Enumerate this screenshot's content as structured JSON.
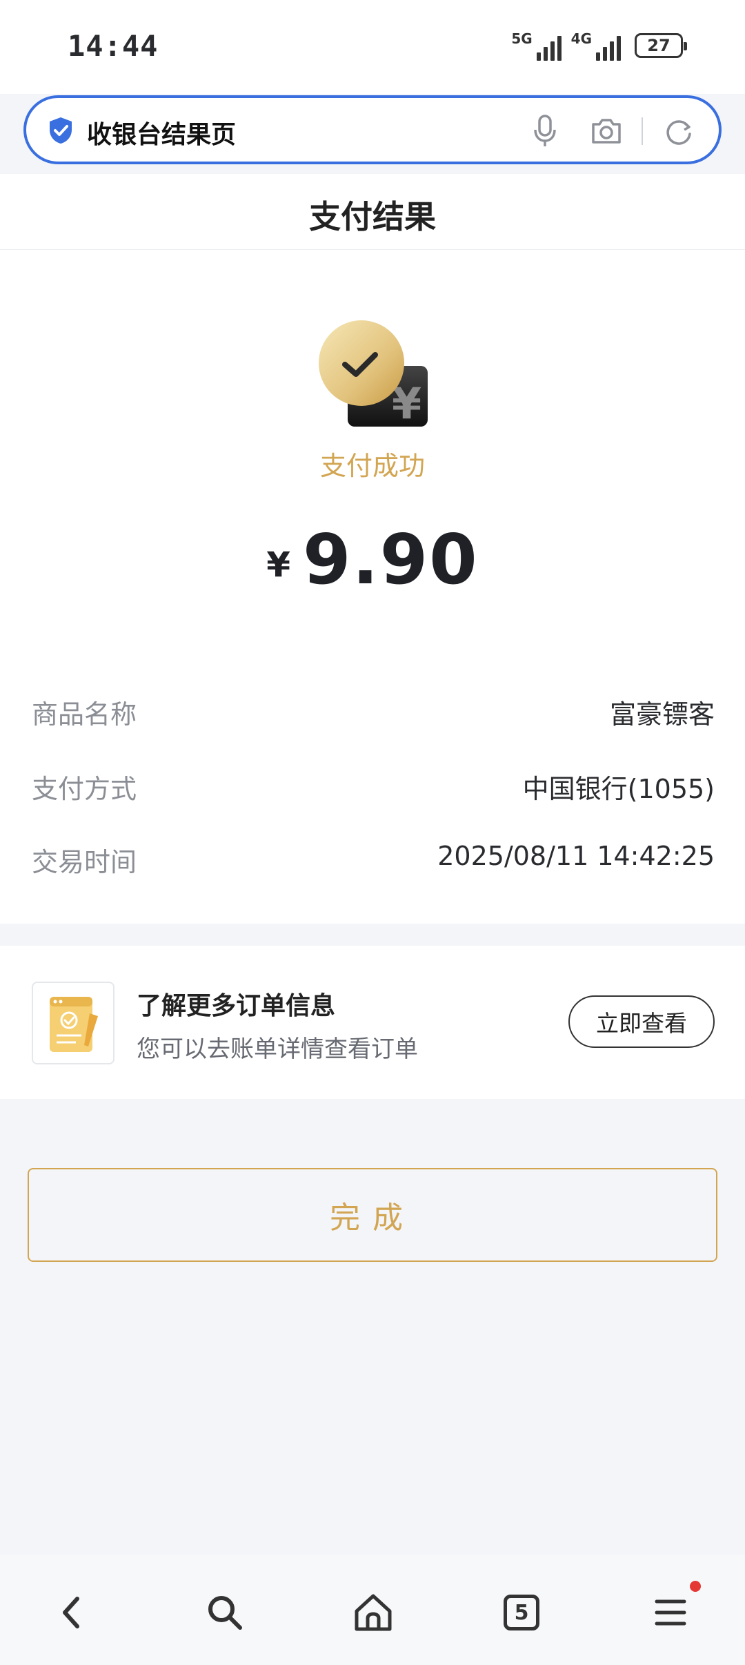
{
  "status_bar": {
    "time": "14:44",
    "network_1": "5G",
    "network_2": "4G",
    "battery": "27"
  },
  "address_bar": {
    "text": "收银台结果页",
    "accent_color": "#3a6fe0"
  },
  "page": {
    "title": "支付结果"
  },
  "result": {
    "status_text": "支付成功",
    "currency_symbol": "¥",
    "amount": "9.90",
    "accent_color": "#d2a552"
  },
  "details": [
    {
      "label": "商品名称",
      "value": "富豪镖客"
    },
    {
      "label": "支付方式",
      "value": "中国银行(1055)"
    },
    {
      "label": "交易时间",
      "value": "2025/08/11 14:42:25"
    }
  ],
  "order_info": {
    "title": "了解更多订单信息",
    "subtitle": "您可以去账单详情查看订单",
    "button_label": "立即查看"
  },
  "done_button": {
    "label": "完成"
  },
  "bottom_nav": {
    "tab_count": "5",
    "items": [
      "back-icon",
      "search-icon",
      "home-icon",
      "tabs-icon",
      "menu-icon"
    ]
  }
}
